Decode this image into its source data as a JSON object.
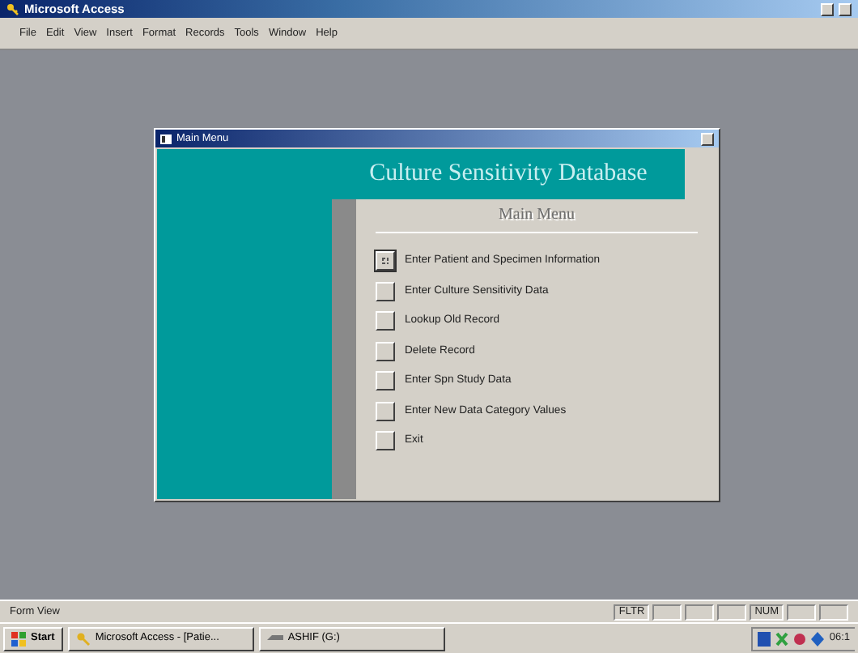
{
  "window": {
    "title": "Microsoft Access"
  },
  "menu": [
    "File",
    "Edit",
    "View",
    "Insert",
    "Format",
    "Records",
    "Tools",
    "Window",
    "Help"
  ],
  "dialog": {
    "title": "Main Menu",
    "heading": "Culture Sensitivity Database",
    "subheading": "Main Menu",
    "items": [
      {
        "label": "Enter Patient and Specimen Information",
        "selected": true
      },
      {
        "label": "Enter Culture Sensitivity Data",
        "selected": false
      },
      {
        "label": "Lookup Old Record",
        "selected": false
      },
      {
        "label": "Delete Record",
        "selected": false
      },
      {
        "label": "Enter Spn Study Data",
        "selected": false
      },
      {
        "label": "Enter New Data Category Values",
        "selected": false
      },
      {
        "label": "Exit",
        "selected": false
      }
    ]
  },
  "status_bar": {
    "text": "Form View",
    "panes": [
      {
        "kind": "text",
        "text": "FLTR"
      },
      {
        "kind": "blank"
      },
      {
        "kind": "blank"
      },
      {
        "kind": "blank"
      },
      {
        "kind": "text",
        "text": "NUM"
      },
      {
        "kind": "blank"
      },
      {
        "kind": "blank"
      }
    ]
  },
  "taskbar": {
    "start": "Start",
    "tasks": [
      {
        "label": "Microsoft Access - [Patie...",
        "kind": "access"
      },
      {
        "label": "ASHIF (G:)",
        "kind": "drive"
      }
    ],
    "clock": "06:1"
  }
}
